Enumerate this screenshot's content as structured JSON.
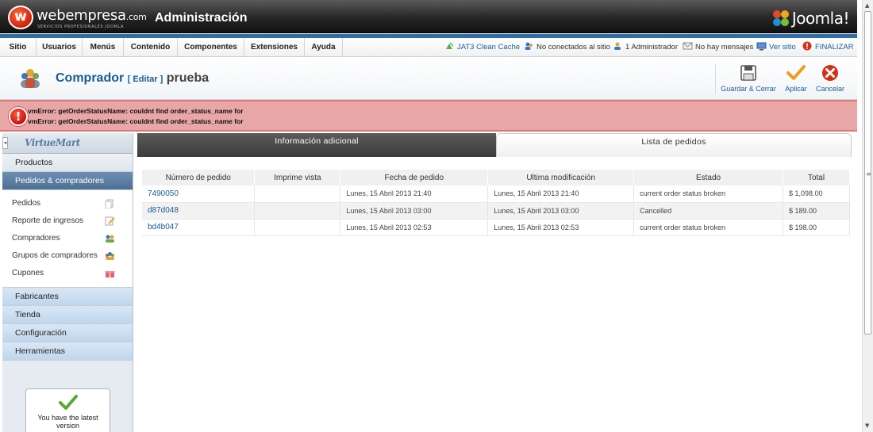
{
  "header": {
    "brand": "webempresa",
    "brand_suffix": ".com",
    "brand_tagline": "SERVICIOS PROFESIONALES JOOMLA",
    "title": "Administración",
    "joomla_logo": "Joomla!"
  },
  "menubar": {
    "items": [
      "Sitio",
      "Usuarios",
      "Menús",
      "Contenido",
      "Componentes",
      "Extensiones",
      "Ayuda"
    ],
    "status": {
      "cache": "JAT3 Clean Cache",
      "site_users": "No conectados al sitio",
      "admins": "1 Administrador",
      "messages": "No hay mensajes",
      "view_site": "Ver sitio",
      "logout": "FINALIZAR"
    }
  },
  "toolbar": {
    "title": "Comprador",
    "edit_label": "[ Editar ]",
    "name": "prueba",
    "save_close": "Guardar & Cerrar",
    "apply": "Aplicar",
    "cancel": "Cancelar"
  },
  "errors": [
    "vmError: getOrderStatusName: couldnt find order_status_name for",
    "vmError: getOrderStatusName: couldnt find order_status_name for"
  ],
  "sidebar": {
    "logo": "VirtueMart",
    "collapse_glyph": "◂",
    "sections": {
      "productos": "Productos",
      "pedidos": "Pedidos & compradores",
      "fabricantes": "Fabricantes",
      "tienda": "Tienda",
      "configuracion": "Configuración",
      "herramientas": "Herramientas"
    },
    "subitems": [
      "Pedidos",
      "Reporte de ingresos",
      "Compradores",
      "Grupos de compradores",
      "Cupones"
    ],
    "latest_version": "You have the latest version"
  },
  "tabs": {
    "info": "Información adicional",
    "orders": "Lista de pedidos"
  },
  "orders_table": {
    "headers": [
      "Número de pedido",
      "Imprime vista",
      "Fecha de pedido",
      "Ultima modificación",
      "Estado",
      "Total"
    ],
    "rows": [
      [
        "7490050",
        "",
        "Lunes, 15 Abril 2013 21:40",
        "Lunes, 15 Abril 2013 21:40",
        "current order status broken",
        "$ 1,098.00"
      ],
      [
        "d87d048",
        "",
        "Lunes, 15 Abril 2013 03:00",
        "Lunes, 15 Abril 2013 03:00",
        "Cancelled",
        "$ 189.00"
      ],
      [
        "bd4b047",
        "",
        "Lunes, 15 Abril 2013 02:53",
        "Lunes, 15 Abril 2013 02:53",
        "current order status broken",
        "$ 198.00"
      ]
    ]
  },
  "scrollbar": {
    "up_glyph": "▲",
    "down_glyph": "▼",
    "grip_glyph": "≡"
  },
  "colors": {
    "accent_blue": "#1a5b91",
    "active_section": "#4c6f94",
    "error_bg": "#e9a6a6"
  }
}
